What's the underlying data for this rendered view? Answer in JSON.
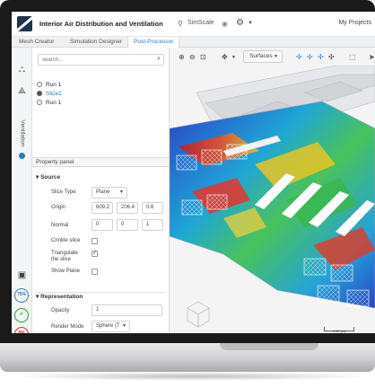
{
  "app": {
    "title": "Interior Air Distribution and Ventilation",
    "org": "SimScale",
    "projects": "My Projects"
  },
  "tabs": [
    {
      "label": "Mesh Creator"
    },
    {
      "label": "Simulation Designer"
    },
    {
      "label": "Post-Processor",
      "active": true
    }
  ],
  "rail": {
    "label": "Ventilation",
    "jobs": [
      {
        "label": "75%",
        "color": "#2b78c5"
      },
      {
        "label": "✔",
        "color": "#2ca02c"
      },
      {
        "label": "0%",
        "color": "#d62728"
      }
    ]
  },
  "search": {
    "placeholder": "search..."
  },
  "tree": [
    {
      "label": "Run 1"
    },
    {
      "label": "Slice1",
      "selected": true
    },
    {
      "label": "Run 1"
    }
  ],
  "property_panel": {
    "title": "Property panel",
    "source": {
      "header": "Source",
      "slice_type_label": "Slice Type",
      "slice_type_value": "Plane",
      "origin_label": "Origin",
      "origin": [
        "609.2",
        "206.4",
        "0.6"
      ],
      "normal_label": "Normal",
      "normal": [
        "0",
        "0",
        "1"
      ],
      "crinkle_label": "Crinkle slice",
      "triangulate_label_1": "Triangulate",
      "triangulate_label_2": "the slice",
      "show_plane_label": "Show Plane"
    },
    "representation": {
      "header": "Representation",
      "opacity_label": "Opacity",
      "opacity_value": "1",
      "render_mode_label": "Render Mode",
      "render_mode_value": "Sphere (T"
    }
  },
  "viewport": {
    "surfaces_label": "Surfaces",
    "scale_label": "4.00 (m)"
  },
  "colors": {
    "accent": "#2b78c5",
    "logo": "#1f3350",
    "bezel": "#1a1a1a"
  }
}
